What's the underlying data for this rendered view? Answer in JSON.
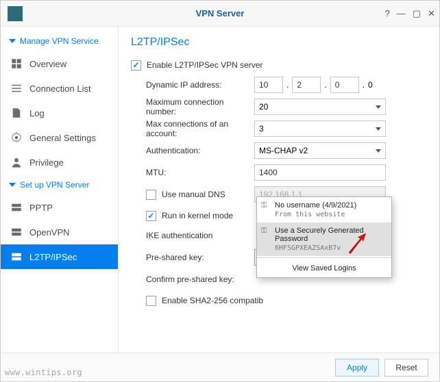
{
  "titlebar": {
    "title": "VPN Server"
  },
  "sidebar": {
    "section1": "Manage VPN Service",
    "overview": "Overview",
    "connection_list": "Connection List",
    "log": "Log",
    "general_settings": "General Settings",
    "privilege": "Privilege",
    "section2": "Set up VPN Server",
    "pptp": "PPTP",
    "openvpn": "OpenVPN",
    "l2tp": "L2TP/IPSec"
  },
  "page": {
    "title": "L2TP/IPSec",
    "enable_label": "Enable L2TP/IPSec VPN server",
    "dynamic_ip_label": "Dynamic IP address:",
    "ip": {
      "a": "10",
      "b": "2",
      "c": "0",
      "d": "0"
    },
    "max_conn_label": "Maximum connection number:",
    "max_conn_value": "20",
    "max_acct_label": "Max connections of an account:",
    "max_acct_value": "3",
    "auth_label": "Authentication:",
    "auth_value": "MS-CHAP v2",
    "mtu_label": "MTU:",
    "mtu_value": "1400",
    "manual_dns_label": "Use manual DNS",
    "manual_dns_value": "192.168.1.1",
    "kernel_label": "Run in kernel mode",
    "ike_label": "IKE authentication",
    "psk_label": "Pre-shared key:",
    "psk_confirm_label": "Confirm pre-shared key:",
    "sha2_label": "Enable SHA2-256 compatib"
  },
  "popup": {
    "item1_title": "No username (4/9/2021)",
    "item1_sub": "From this website",
    "item2_title": "Use a Securely Generated Password",
    "item2_sub": "6HFSGPXEAZSAxB7v",
    "view": "View Saved Logins"
  },
  "footer": {
    "apply": "Apply",
    "reset": "Reset"
  },
  "watermark": "www.wintips.org"
}
